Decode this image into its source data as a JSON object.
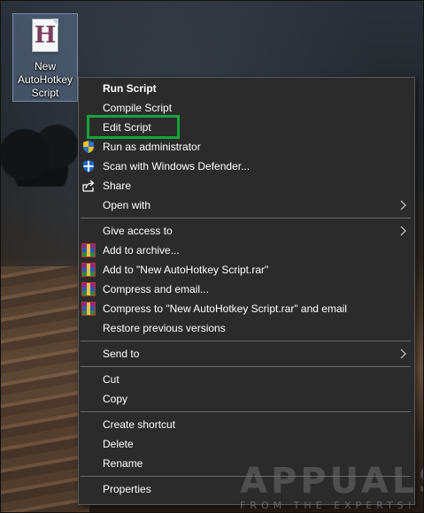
{
  "desktop": {
    "file_icon_letter": "H",
    "file_label_lines": [
      "New",
      "AutoHotkey",
      "Script"
    ]
  },
  "context_menu": {
    "items": [
      {
        "label": "Run Script",
        "bold": true,
        "icon": null
      },
      {
        "label": "Compile Script",
        "icon": null
      },
      {
        "label": "Edit Script",
        "icon": null,
        "highlighted": true
      },
      {
        "label": "Run as administrator",
        "icon": "uac-shield-icon"
      },
      {
        "label": "Scan with Windows Defender...",
        "icon": "defender-icon"
      },
      {
        "label": "Share",
        "icon": "share-icon"
      },
      {
        "label": "Open with",
        "icon": null,
        "submenu": true
      },
      {
        "label": "Give access to",
        "icon": null,
        "submenu": true
      },
      {
        "label": "Add to archive...",
        "icon": "winrar-icon"
      },
      {
        "label": "Add to \"New AutoHotkey Script.rar\"",
        "icon": "winrar-icon"
      },
      {
        "label": "Compress and email...",
        "icon": "winrar-icon"
      },
      {
        "label": "Compress to \"New AutoHotkey Script.rar\" and email",
        "icon": "winrar-icon"
      },
      {
        "label": "Restore previous versions",
        "icon": null
      },
      {
        "label": "Send to",
        "icon": null,
        "submenu": true
      },
      {
        "label": "Cut",
        "icon": null
      },
      {
        "label": "Copy",
        "icon": null
      },
      {
        "label": "Create shortcut",
        "icon": null
      },
      {
        "label": "Delete",
        "icon": null
      },
      {
        "label": "Rename",
        "icon": null
      },
      {
        "label": "Properties",
        "icon": null
      }
    ]
  },
  "watermark": {
    "brand": "APPUALS",
    "tagline": "FROM THE EXPERTS!"
  },
  "colors": {
    "menu_bg": "#2b2b2b",
    "highlight_border": "#14a53c",
    "text": "#ffffff"
  }
}
